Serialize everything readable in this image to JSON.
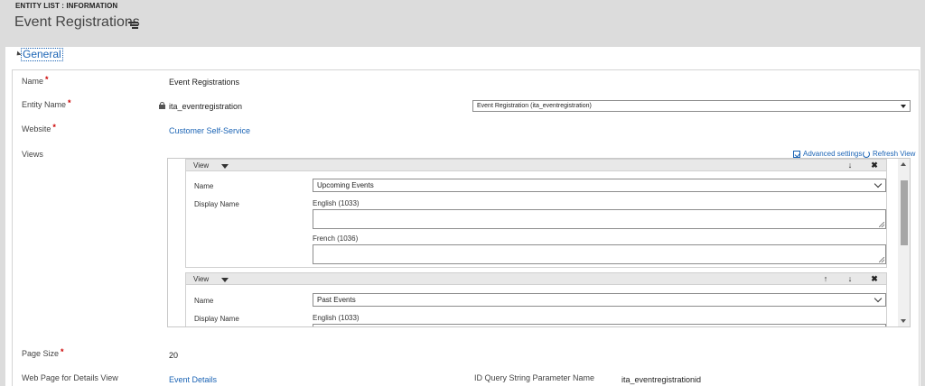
{
  "header": {
    "entity_label": "ENTITY LIST : INFORMATION",
    "title": "Event Registrations"
  },
  "section": {
    "title": "General"
  },
  "fields": {
    "name_label": "Name",
    "name_value": "Event Registrations",
    "entity_name_label": "Entity Name",
    "entity_name_value": "ita_eventregistration",
    "entity_select_value": "Event Registration (ita_eventregistration)",
    "website_label": "Website",
    "website_value": "Customer Self-Service",
    "views_label": "Views",
    "page_size_label": "Page Size",
    "page_size_value": "20",
    "details_page_label": "Web Page for Details View",
    "details_page_value": "Event Details",
    "id_query_label": "ID Query String Parameter Name",
    "id_query_value": "ita_eventregistrationid",
    "required_mark": "*"
  },
  "views_toolbar": {
    "advanced_settings": "Advanced settings",
    "refresh_view": "Refresh View"
  },
  "views": [
    {
      "header": "View",
      "name_label": "Name",
      "name_value": "Upcoming Events",
      "display_name_label": "Display Name",
      "lang1": "English (1033)",
      "lang2": "French (1036)"
    },
    {
      "header": "View",
      "name_label": "Name",
      "name_value": "Past Events",
      "display_name_label": "Display Name",
      "lang1": "English (1033)"
    }
  ],
  "controls": {
    "up": "↑",
    "down": "↓",
    "remove": "✖"
  }
}
